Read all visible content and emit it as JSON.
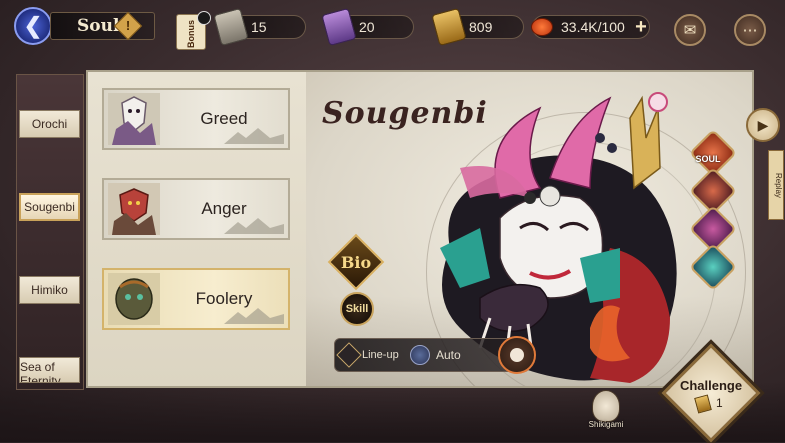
{
  "header": {
    "title": "Soul",
    "bonus_label": "Bonus"
  },
  "resources": [
    {
      "name": "amulet-icon",
      "value": "15"
    },
    {
      "name": "mystery-amulet-icon",
      "value": "20"
    },
    {
      "name": "jade-icon",
      "value": "809"
    },
    {
      "name": "stamina-icon",
      "value": "33.4K/100"
    }
  ],
  "tabs": [
    {
      "label": "Orochi"
    },
    {
      "label": "Sougenbi"
    },
    {
      "label": "Himiko"
    },
    {
      "label": "Sea of Eternity"
    }
  ],
  "difficulties": [
    {
      "label": "Greed"
    },
    {
      "label": "Anger"
    },
    {
      "label": "Foolery"
    }
  ],
  "boss": {
    "name": "Sougenbi",
    "bio_label": "Bio",
    "skill_label": "Skill"
  },
  "lineup": {
    "lineup_label": "Line-up",
    "auto_label": "Auto"
  },
  "side": {
    "soul_label": "SOUL",
    "replay_label": "Replay"
  },
  "challenge": {
    "label": "Challenge",
    "cost": "1"
  },
  "shikigami": {
    "label": "Shikigami"
  }
}
